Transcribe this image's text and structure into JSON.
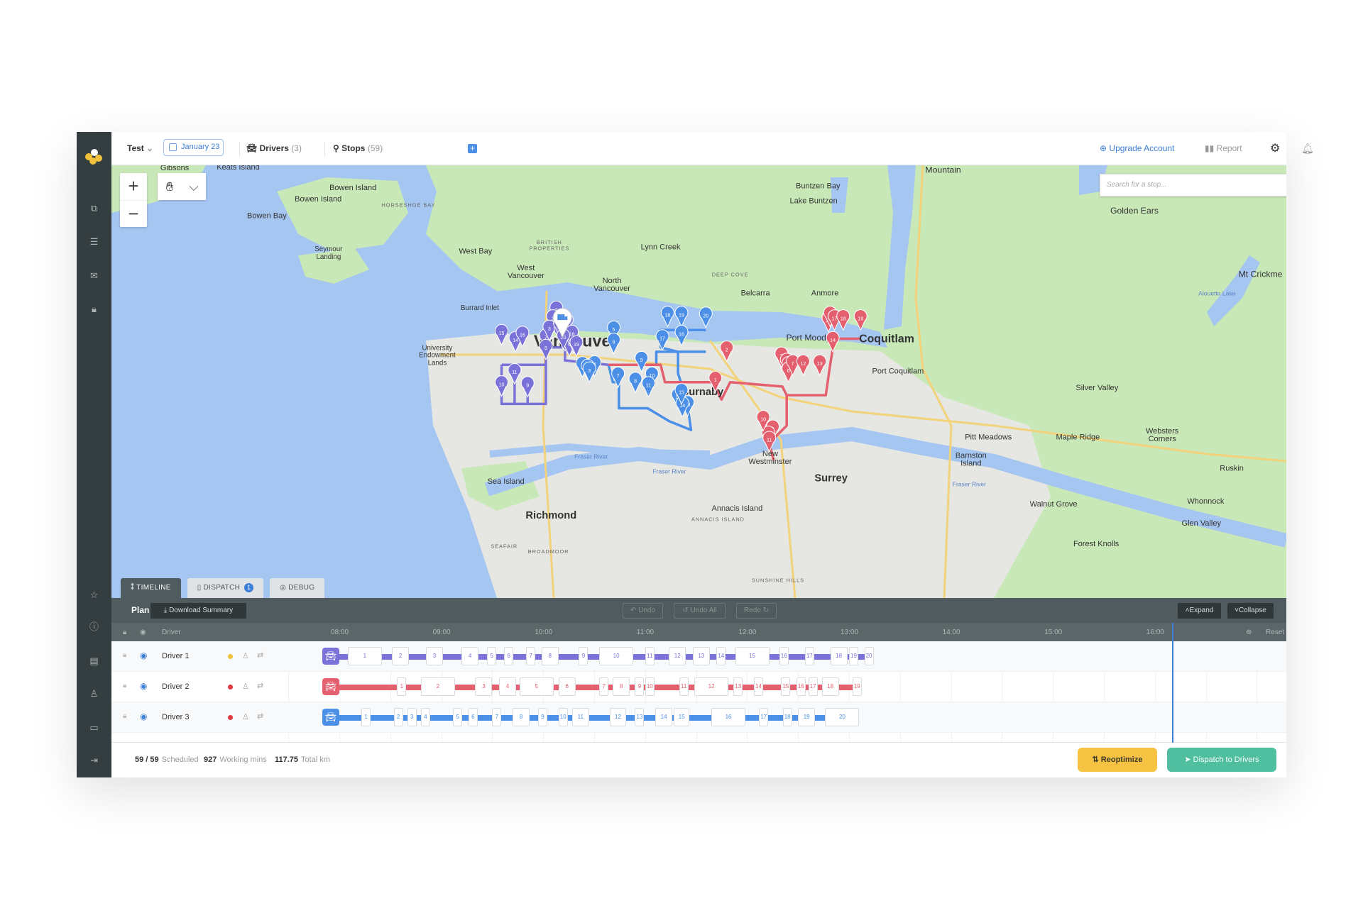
{
  "topbar": {
    "project": "Test",
    "date": "January 23",
    "drivers_label": "Drivers",
    "drivers_count": "(3)",
    "stops_label": "Stops",
    "stops_count": "(59)",
    "upgrade": "Upgrade Account",
    "report": "Report"
  },
  "map": {
    "search_placeholder": "Search for a stop...",
    "labels": [
      "Gibsons",
      "Keats Island",
      "Bowen Island",
      "Bowen Island",
      "Bowen Bay",
      "HORSESHOE BAY",
      "Seymour",
      "Landing",
      "West Bay",
      "BRITISH",
      "PROPERTIES",
      "West",
      "Vancouver",
      "Lynn Creek",
      "North",
      "Vancouver",
      "DEEP COVE",
      "Belcarra",
      "Anmore",
      "Buntzen Bay",
      "Lake Buntzen",
      "Mountain",
      "Golden Ears",
      "Mt Crickme",
      "Burrard Inlet",
      "University",
      "Endowment",
      "Lands",
      "Vancouver",
      "Burnaby",
      "Port Moody",
      "Coquitlam",
      "Port Coquitlam",
      "Silver Valley",
      "Pitt Meadows",
      "Maple Ridge",
      "Websters",
      "Corners",
      "Barnston",
      "Island",
      "Ruskin",
      "New",
      "Westminster",
      "Surrey",
      "Sea Island",
      "Richmond",
      "Walnut Grove",
      "Whonnock",
      "Glen Valley",
      "Annacis Island",
      "ANNACIS ISLAND",
      "SEAFAIR",
      "BROADMOOR",
      "Forest Knolls",
      "SUNSHINE HILLS",
      "Fraser River",
      "Fraser River",
      "Fraser River",
      "Alouette Lake"
    ]
  },
  "tabs": [
    {
      "label": "TIMELINE"
    },
    {
      "label": "DISPATCH",
      "badge": "1"
    },
    {
      "label": "DEBUG"
    }
  ],
  "timeline": {
    "plan": "Plan",
    "download": "Download Summary",
    "undo": "Undo",
    "undo_all": "Undo All",
    "redo": "Redo",
    "expand": "Expand",
    "collapse": "Collapse",
    "driver_header": "Driver",
    "reset": "Reset",
    "hours": [
      "08:00",
      "09:00",
      "10:00",
      "11:00",
      "12:00",
      "13:00",
      "14:00",
      "15:00",
      "16:00"
    ],
    "current_time": "16:10",
    "drivers": [
      {
        "name": "Driver 1",
        "color": "#7b72d9",
        "status_color": "#f2c13c",
        "stops": [
          {
            "n": "1",
            "start": "08:05",
            "end": "08:25"
          },
          {
            "n": "2",
            "start": "08:31",
            "end": "08:41"
          },
          {
            "n": "3",
            "start": "08:51",
            "end": "09:01"
          },
          {
            "n": "4",
            "start": "09:12",
            "end": "09:22"
          },
          {
            "n": "5",
            "start": "09:27",
            "end": "09:32"
          },
          {
            "n": "6",
            "start": "09:37",
            "end": "09:42"
          },
          {
            "n": "7",
            "start": "09:50",
            "end": "09:55"
          },
          {
            "n": "8",
            "start": "09:59",
            "end": "10:09"
          },
          {
            "n": "9",
            "start": "10:21",
            "end": "10:26"
          },
          {
            "n": "10",
            "start": "10:33",
            "end": "10:53"
          },
          {
            "n": "11",
            "start": "11:00",
            "end": "11:05"
          },
          {
            "n": "12",
            "start": "11:14",
            "end": "11:24"
          },
          {
            "n": "13",
            "start": "11:28",
            "end": "11:38"
          },
          {
            "n": "14",
            "start": "11:42",
            "end": "11:47"
          },
          {
            "n": "15",
            "start": "11:53",
            "end": "12:13"
          },
          {
            "n": "16",
            "start": "12:19",
            "end": "12:24"
          },
          {
            "n": "17",
            "start": "12:34",
            "end": "12:39"
          },
          {
            "n": "18",
            "start": "12:49",
            "end": "12:59"
          },
          {
            "n": "19",
            "start": "13:00",
            "end": "13:05"
          },
          {
            "n": "20",
            "start": "13:09",
            "end": "13:14"
          }
        ]
      },
      {
        "name": "Driver 2",
        "color": "#e4606f",
        "status_color": "#e0383f",
        "stops": [
          {
            "n": "1",
            "start": "08:34",
            "end": "08:39"
          },
          {
            "n": "2",
            "start": "08:48",
            "end": "09:08"
          },
          {
            "n": "3",
            "start": "09:20",
            "end": "09:30"
          },
          {
            "n": "4",
            "start": "09:34",
            "end": "09:44"
          },
          {
            "n": "5",
            "start": "09:46",
            "end": "10:06"
          },
          {
            "n": "6",
            "start": "10:09",
            "end": "10:19"
          },
          {
            "n": "7",
            "start": "10:33",
            "end": "10:37"
          },
          {
            "n": "8",
            "start": "10:41",
            "end": "10:51"
          },
          {
            "n": "9",
            "start": "10:54",
            "end": "10:59"
          },
          {
            "n": "10",
            "start": "11:00",
            "end": "11:05"
          },
          {
            "n": "11",
            "start": "11:20",
            "end": "11:25"
          },
          {
            "n": "12",
            "start": "11:29",
            "end": "11:49"
          },
          {
            "n": "13",
            "start": "11:52",
            "end": "11:57"
          },
          {
            "n": "14",
            "start": "12:04",
            "end": "12:09"
          },
          {
            "n": "15",
            "start": "12:20",
            "end": "12:25"
          },
          {
            "n": "16",
            "start": "12:29",
            "end": "12:34"
          },
          {
            "n": "17",
            "start": "12:36",
            "end": "12:41"
          },
          {
            "n": "18",
            "start": "12:44",
            "end": "12:54"
          },
          {
            "n": "19",
            "start": "13:02",
            "end": "13:07"
          }
        ]
      },
      {
        "name": "Driver 3",
        "color": "#4b8fe6",
        "status_color": "#e0383f",
        "stops": [
          {
            "n": "1",
            "start": "08:13",
            "end": "08:18"
          },
          {
            "n": "2",
            "start": "08:32",
            "end": "08:37"
          },
          {
            "n": "3",
            "start": "08:40",
            "end": "08:45"
          },
          {
            "n": "4",
            "start": "08:48",
            "end": "08:53"
          },
          {
            "n": "5",
            "start": "09:07",
            "end": "09:12"
          },
          {
            "n": "6",
            "start": "09:16",
            "end": "09:21"
          },
          {
            "n": "7",
            "start": "09:30",
            "end": "09:35"
          },
          {
            "n": "8",
            "start": "09:42",
            "end": "09:52"
          },
          {
            "n": "9",
            "start": "09:57",
            "end": "10:02"
          },
          {
            "n": "10",
            "start": "10:09",
            "end": "10:14"
          },
          {
            "n": "11",
            "start": "10:17",
            "end": "10:27"
          },
          {
            "n": "12",
            "start": "10:39",
            "end": "10:49"
          },
          {
            "n": "13",
            "start": "10:54",
            "end": "10:59"
          },
          {
            "n": "14",
            "start": "11:06",
            "end": "11:16"
          },
          {
            "n": "15",
            "start": "11:17",
            "end": "11:26"
          },
          {
            "n": "16",
            "start": "11:39",
            "end": "11:59"
          },
          {
            "n": "17",
            "start": "12:07",
            "end": "12:12"
          },
          {
            "n": "18",
            "start": "12:21",
            "end": "12:26"
          },
          {
            "n": "19",
            "start": "12:30",
            "end": "12:40"
          },
          {
            "n": "20",
            "start": "12:46",
            "end": "13:06"
          }
        ]
      }
    ]
  },
  "footer": {
    "scheduled": "59 / 59",
    "scheduled_label": "Scheduled",
    "working": "927",
    "working_label": "Working mins",
    "km": "117.75",
    "km_label": "Total km",
    "reoptimize": "Reoptimize",
    "dispatch": "Dispatch to Drivers"
  },
  "colors": {
    "accent": "#3d7fd6",
    "reoptimize": "#f5c242",
    "dispatch": "#4fbf9f",
    "sidebar": "#343d3f",
    "timeline_bar": "#4f5b5e"
  }
}
